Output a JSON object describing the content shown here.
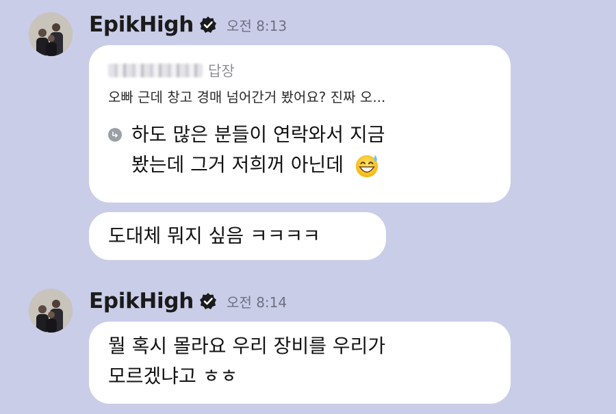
{
  "messages": [
    {
      "sender": "EpikHigh",
      "time": "오전 8:13",
      "reply": {
        "label": "답장",
        "quote": "오빠 근데 창고 경매 넘어간거 봤어요? 진짜 오..."
      },
      "reply_text_line1": "하도 많은 분들이 연락와서 지금",
      "reply_text_line2": "봤는데 그거 저희꺼 아닌데",
      "reply_emoji": "grinning-sweat-emoji",
      "followup": "도대체 뭐지 싶음 ㅋㅋㅋㅋ"
    },
    {
      "sender": "EpikHigh",
      "time": "오전 8:14",
      "text_line1": "뭘 혹시 몰라요 우리 장비를 우리가",
      "text_line2": "모르겠냐고 ㅎㅎ"
    }
  ],
  "colors": {
    "background": "#cacde8",
    "bubble": "#ffffff",
    "time": "#6e6f82",
    "reply_label": "#8e8e96"
  },
  "icons": {
    "verified": "verified-badge-icon",
    "reply": "reply-arrow-icon"
  }
}
